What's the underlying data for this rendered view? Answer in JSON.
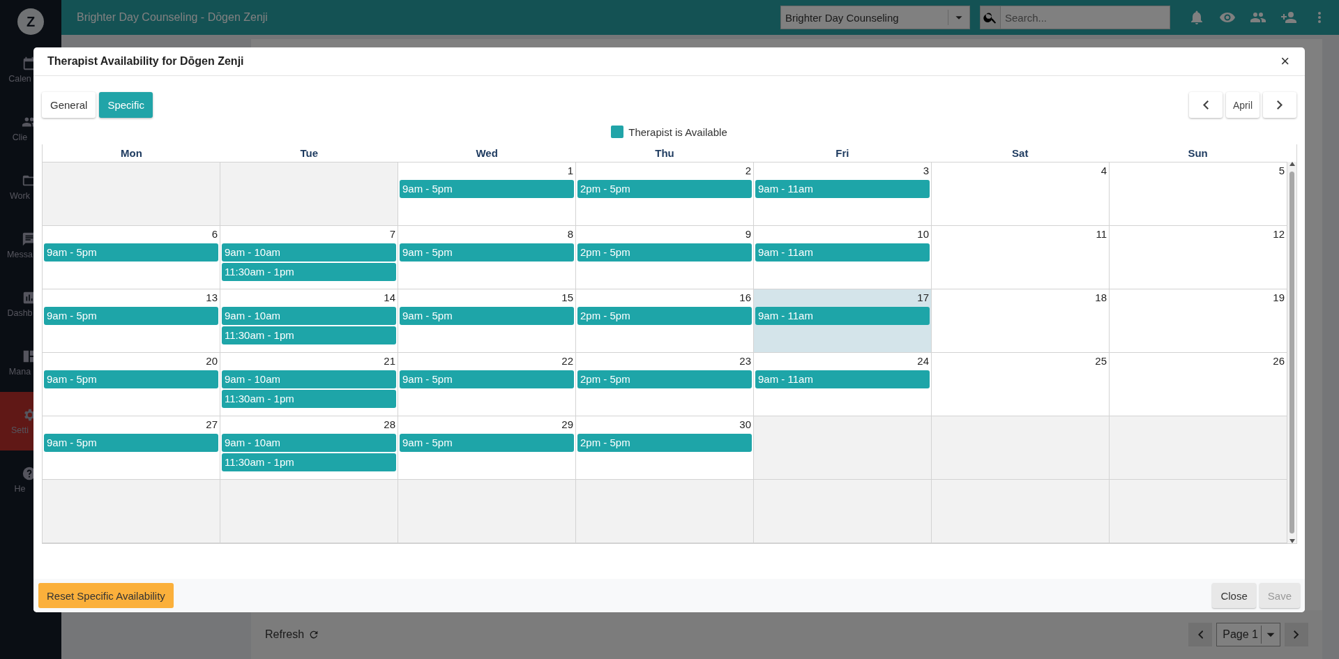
{
  "app": {
    "logo": "Z",
    "title": "Brighter Day Counseling - Dōgen Zenji",
    "practice_select": "Brighter Day Counseling",
    "search": {
      "placeholder": "Search..."
    },
    "sidebar": [
      {
        "label": "Calen",
        "selected": false
      },
      {
        "label": "Clie",
        "selected": false
      },
      {
        "label": "Work",
        "selected": false
      },
      {
        "label": "Messa",
        "selected": false
      },
      {
        "label": "Dashb",
        "selected": false
      },
      {
        "label": "Mana",
        "selected": false
      },
      {
        "label": "Setti",
        "selected": true
      },
      {
        "label": "He",
        "selected": false
      }
    ],
    "footer": {
      "refresh": "Refresh",
      "page": "Page 1"
    }
  },
  "modal": {
    "title": "Therapist Availability for Dōgen Zenji",
    "close": "×",
    "tabs": [
      {
        "label": "General",
        "selected": false
      },
      {
        "label": "Specific",
        "selected": true
      }
    ],
    "month": "April",
    "legend": "Therapist is Available",
    "weekdays": [
      "Mon",
      "Tue",
      "Wed",
      "Thu",
      "Fri",
      "Sat",
      "Sun"
    ],
    "weeks": [
      [
        {
          "kind": "blank"
        },
        {
          "kind": "blank"
        },
        {
          "kind": "day",
          "number": "1",
          "today": false,
          "slots": [
            "9am - 5pm"
          ]
        },
        {
          "kind": "day",
          "number": "2",
          "today": false,
          "slots": [
            "2pm - 5pm"
          ]
        },
        {
          "kind": "day",
          "number": "3",
          "today": false,
          "slots": [
            "9am - 11am"
          ]
        },
        {
          "kind": "day",
          "number": "4",
          "today": false
        },
        {
          "kind": "day",
          "number": "5",
          "today": false
        }
      ],
      [
        {
          "kind": "day",
          "number": "6",
          "today": false,
          "slots": [
            "9am - 5pm"
          ]
        },
        {
          "kind": "day",
          "number": "7",
          "today": false,
          "slots": [
            "9am - 10am",
            "11:30am - 1pm"
          ]
        },
        {
          "kind": "day",
          "number": "8",
          "today": false,
          "slots": [
            "9am - 5pm"
          ]
        },
        {
          "kind": "day",
          "number": "9",
          "today": false,
          "slots": [
            "2pm - 5pm"
          ]
        },
        {
          "kind": "day",
          "number": "10",
          "today": false,
          "slots": [
            "9am - 11am"
          ]
        },
        {
          "kind": "day",
          "number": "11",
          "today": false
        },
        {
          "kind": "day",
          "number": "12",
          "today": false
        }
      ],
      [
        {
          "kind": "day",
          "number": "13",
          "today": false,
          "slots": [
            "9am - 5pm"
          ]
        },
        {
          "kind": "day",
          "number": "14",
          "today": false,
          "slots": [
            "9am - 10am",
            "11:30am - 1pm"
          ]
        },
        {
          "kind": "day",
          "number": "15",
          "today": false,
          "slots": [
            "9am - 5pm"
          ]
        },
        {
          "kind": "day",
          "number": "16",
          "today": false,
          "slots": [
            "2pm - 5pm"
          ]
        },
        {
          "kind": "day",
          "number": "17",
          "today": true,
          "slots": [
            "9am - 11am"
          ]
        },
        {
          "kind": "day",
          "number": "18",
          "today": false
        },
        {
          "kind": "day",
          "number": "19",
          "today": false
        }
      ],
      [
        {
          "kind": "day",
          "number": "20",
          "today": false,
          "slots": [
            "9am - 5pm"
          ]
        },
        {
          "kind": "day",
          "number": "21",
          "today": false,
          "slots": [
            "9am - 10am",
            "11:30am - 1pm"
          ]
        },
        {
          "kind": "day",
          "number": "22",
          "today": false,
          "slots": [
            "9am - 5pm"
          ]
        },
        {
          "kind": "day",
          "number": "23",
          "today": false,
          "slots": [
            "2pm - 5pm"
          ]
        },
        {
          "kind": "day",
          "number": "24",
          "today": false,
          "slots": [
            "9am - 11am"
          ]
        },
        {
          "kind": "day",
          "number": "25",
          "today": false
        },
        {
          "kind": "day",
          "number": "26",
          "today": false
        }
      ],
      [
        {
          "kind": "day",
          "number": "27",
          "today": false,
          "slots": [
            "9am - 5pm"
          ]
        },
        {
          "kind": "day",
          "number": "28",
          "today": false,
          "slots": [
            "9am - 10am",
            "11:30am - 1pm"
          ]
        },
        {
          "kind": "day",
          "number": "29",
          "today": false,
          "slots": [
            "9am - 5pm"
          ]
        },
        {
          "kind": "day",
          "number": "30",
          "today": false,
          "slots": [
            "2pm - 5pm"
          ]
        },
        {
          "kind": "blank"
        },
        {
          "kind": "blank"
        },
        {
          "kind": "blank"
        }
      ],
      [
        {
          "kind": "blank"
        },
        {
          "kind": "blank"
        },
        {
          "kind": "blank"
        },
        {
          "kind": "blank"
        },
        {
          "kind": "blank"
        },
        {
          "kind": "blank"
        },
        {
          "kind": "blank"
        }
      ]
    ],
    "reset": "Reset Specific Availability",
    "buttons": [
      {
        "label": "Close",
        "disabled": false
      },
      {
        "label": "Save",
        "disabled": true
      }
    ]
  }
}
